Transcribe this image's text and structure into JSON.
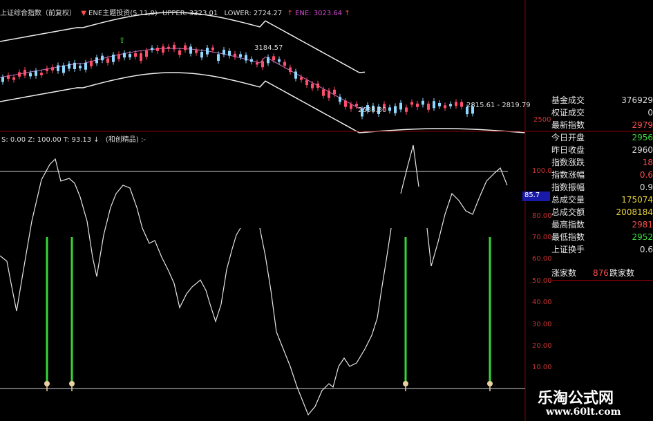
{
  "top_header": {
    "title": "上证综合指数（前复权）",
    "indicator": "ENE主题投资(5,11,9)",
    "upper": "UPPER: 3323.01",
    "lower": "LOWER: 2724.27",
    "ene": "ENE: 3023.64"
  },
  "top_chart": {
    "annotations": {
      "high": "3184.57",
      "low": "2638.30",
      "range": "2815.61 - 2819.79"
    },
    "axis_tick": "2500"
  },
  "osc_header": {
    "params": "S: 0.00  Z: 100.00  T: 93.13",
    "name": "(和创精品) :-"
  },
  "osc_axis": {
    "ticks": [
      "100.0",
      "80.00",
      "70.00",
      "60.00",
      "50.00",
      "40.00",
      "30.00",
      "20.00",
      "10.00"
    ],
    "highlight": "85.7"
  },
  "osc_series": {
    "values": [
      [
        0,
        370
      ],
      [
        10,
        378
      ],
      [
        18,
        420
      ],
      [
        24,
        450
      ],
      [
        34,
        390
      ],
      [
        46,
        320
      ],
      [
        60,
        260
      ],
      [
        72,
        238
      ],
      [
        80,
        230
      ],
      [
        88,
        262
      ],
      [
        100,
        258
      ],
      [
        108,
        265
      ],
      [
        116,
        285
      ],
      [
        126,
        320
      ],
      [
        134,
        372
      ],
      [
        140,
        400
      ],
      [
        150,
        340
      ],
      [
        160,
        300
      ],
      [
        168,
        280
      ],
      [
        178,
        268
      ],
      [
        188,
        272
      ],
      [
        198,
        300
      ],
      [
        206,
        330
      ],
      [
        216,
        352
      ],
      [
        224,
        348
      ],
      [
        234,
        372
      ],
      [
        244,
        392
      ],
      [
        252,
        410
      ],
      [
        260,
        445
      ],
      [
        270,
        425
      ],
      [
        278,
        415
      ],
      [
        290,
        405
      ],
      [
        298,
        420
      ],
      [
        304,
        440
      ],
      [
        312,
        465
      ],
      [
        320,
        440
      ],
      [
        328,
        390
      ],
      [
        336,
        360
      ],
      [
        342,
        340
      ],
      [
        348,
        330
      ],
      null,
      [
        376,
        330
      ],
      [
        384,
        370
      ],
      [
        392,
        420
      ],
      [
        400,
        480
      ],
      [
        410,
        505
      ],
      [
        420,
        530
      ],
      [
        430,
        560
      ],
      [
        438,
        580
      ],
      [
        446,
        600
      ],
      [
        456,
        588
      ],
      [
        466,
        565
      ],
      [
        476,
        555
      ],
      [
        482,
        560
      ],
      [
        490,
        530
      ],
      [
        498,
        518
      ],
      [
        506,
        530
      ],
      [
        516,
        525
      ],
      [
        528,
        505
      ],
      [
        538,
        485
      ],
      [
        546,
        460
      ],
      [
        552,
        420
      ],
      [
        560,
        370
      ],
      [
        566,
        330
      ],
      null,
      [
        580,
        280
      ],
      [
        590,
        240
      ],
      [
        598,
        210
      ],
      [
        606,
        270
      ],
      null,
      [
        618,
        330
      ],
      [
        624,
        385
      ],
      [
        634,
        350
      ],
      [
        644,
        310
      ],
      [
        654,
        280
      ],
      [
        664,
        290
      ],
      [
        674,
        305
      ],
      [
        684,
        310
      ],
      [
        694,
        285
      ],
      [
        704,
        262
      ],
      [
        716,
        250
      ],
      [
        724,
        243
      ],
      [
        734,
        268
      ]
    ],
    "signals_x": [
      68,
      104,
      587,
      709
    ]
  },
  "side_panel": {
    "rows": [
      {
        "label": "基金成交",
        "value": "376929",
        "color": "#ddd"
      },
      {
        "label": "权证成交",
        "value": "0",
        "color": "#ddd"
      },
      {
        "label": "最新指数",
        "value": "2979",
        "color": "#ff4d4d"
      },
      {
        "label": "今日开盘",
        "value": "2956",
        "color": "#3ddc3d"
      },
      {
        "label": "昨日收盘",
        "value": "2960",
        "color": "#ddd"
      },
      {
        "label": "指数涨跌",
        "value": "18",
        "color": "#ff4d4d"
      },
      {
        "label": "指数涨幅",
        "value": "0.6",
        "color": "#ff4d4d"
      },
      {
        "label": "指数振幅",
        "value": "0.9",
        "color": "#ddd"
      },
      {
        "label": "总成交量",
        "value": "175074",
        "color": "#e8d43a"
      },
      {
        "label": "总成交额",
        "value": "2008184",
        "color": "#e8d43a"
      },
      {
        "label": "最高指数",
        "value": "2981",
        "color": "#ff4d4d"
      },
      {
        "label": "最低指数",
        "value": "2952",
        "color": "#3ddc3d"
      },
      {
        "label": "上证换手",
        "value": "0.6",
        "color": "#ddd"
      }
    ],
    "advance_label": "涨家数",
    "advance_value": "876",
    "decline_label": "跌家数"
  },
  "watermark": {
    "title": "乐淘公式网",
    "url": "www.60lt.com"
  }
}
